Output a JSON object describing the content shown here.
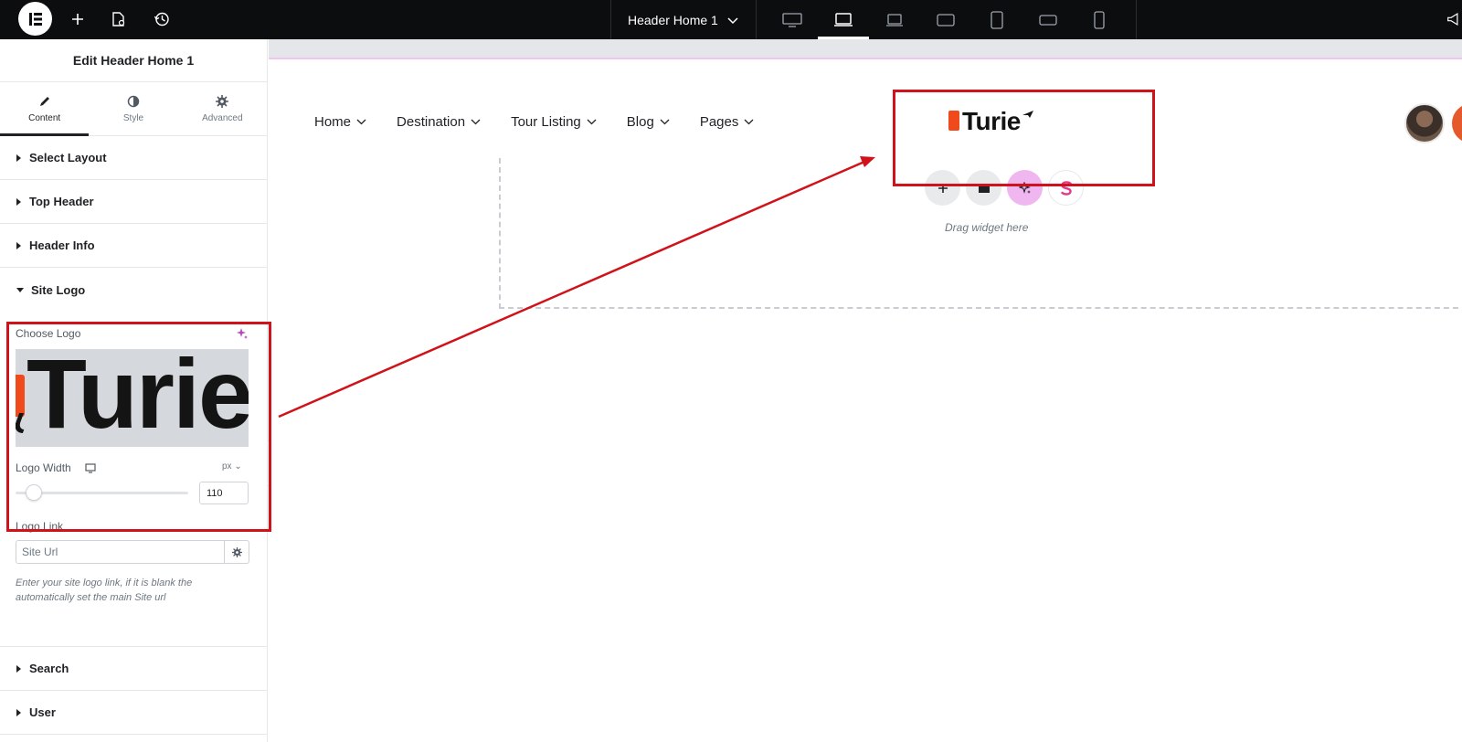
{
  "topbar": {
    "document_title": "Header Home 1",
    "icons": [
      "elementor-logo-icon",
      "add-icon",
      "page-settings-icon",
      "history-icon",
      "chevron-down-icon",
      "desktop-icon",
      "laptop-icon",
      "widescreen-icon",
      "tablet-landscape-icon",
      "tablet-portrait-icon",
      "mobile-landscape-icon",
      "mobile-portrait-icon",
      "megaphone-icon"
    ]
  },
  "panel": {
    "title": "Edit Header Home 1",
    "tabs": [
      {
        "label": "Content",
        "icon": "pencil-icon"
      },
      {
        "label": "Style",
        "icon": "half-circle-icon"
      },
      {
        "label": "Advanced",
        "icon": "gear-icon"
      }
    ],
    "sections_top": [
      "Select Layout",
      "Top Header",
      "Header Info"
    ],
    "open_section": "Site Logo",
    "logo_controls": {
      "choose_logo_label": "Choose Logo",
      "logo_width_label": "Logo Width",
      "unit": "px",
      "logo_width_value": "110",
      "logo_link_label": "Logo Link",
      "url_placeholder": "Site Url",
      "help_text": "Enter your site logo link, if it is blank the automatically set the main Site url",
      "preview_text": "Turie"
    },
    "sections_bottom": [
      "Search",
      "User"
    ]
  },
  "canvas": {
    "nav_items": [
      "Home",
      "Destination",
      "Tour Listing",
      "Blog",
      "Pages"
    ],
    "site_logo_text": "Turie",
    "drag_hint": "Drag widget here"
  },
  "colors": {
    "topbar_bg": "#0c0d0e",
    "annotation_red": "#d0121b",
    "ai_pink": "#f0b6f0",
    "logo_orange": "#f04a1c"
  }
}
